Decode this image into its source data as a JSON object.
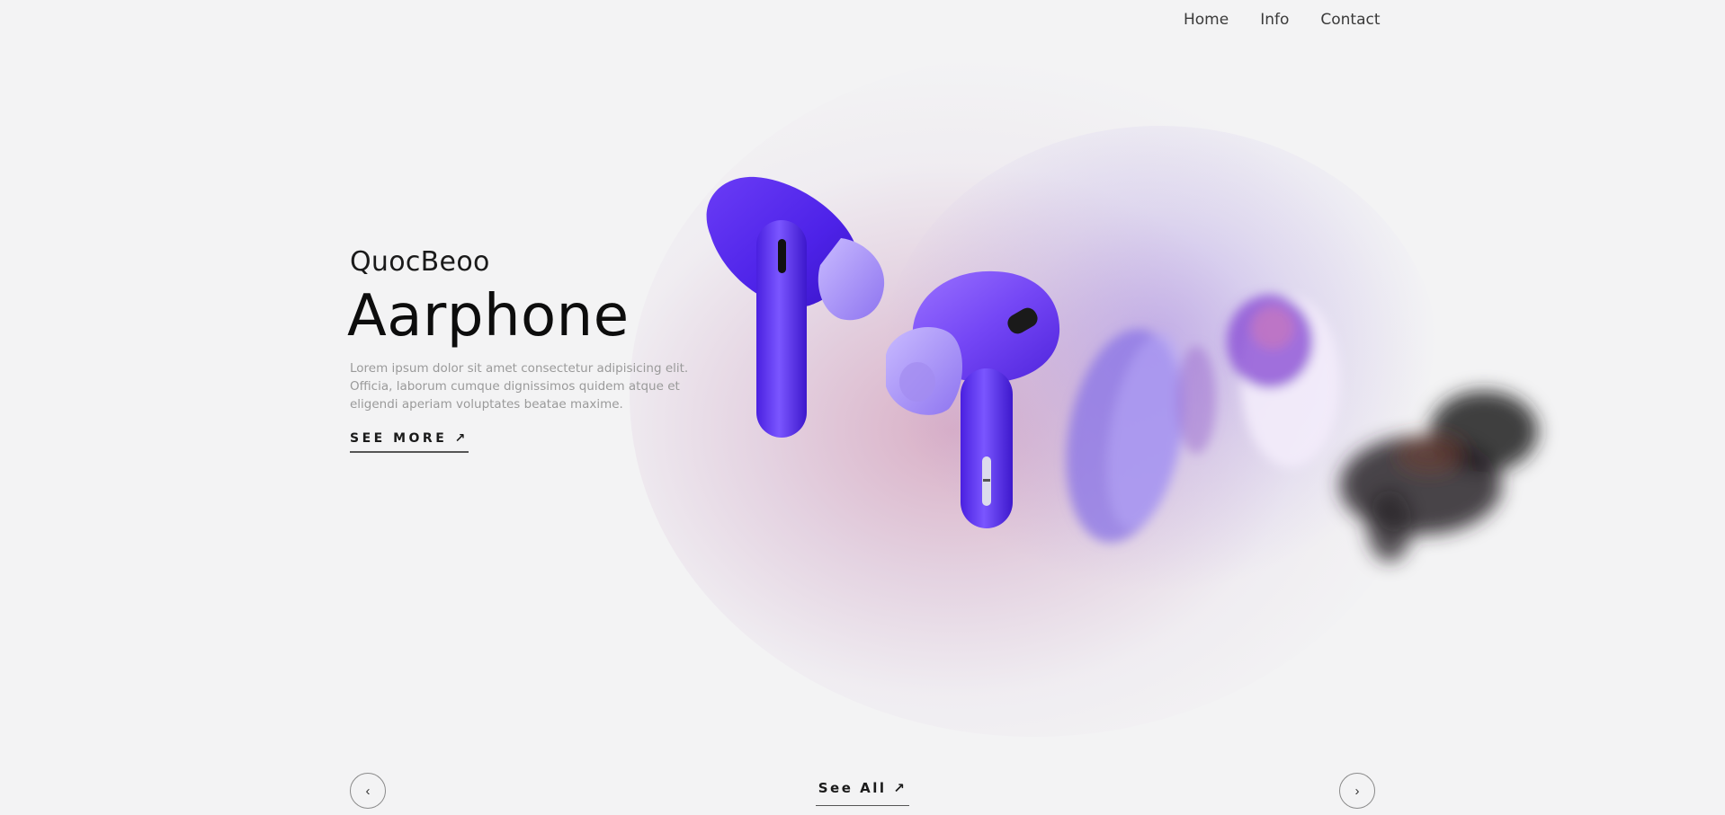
{
  "nav": {
    "items": [
      {
        "label": "Home"
      },
      {
        "label": "Info"
      },
      {
        "label": "Contact"
      }
    ]
  },
  "hero": {
    "brand": "QuocBeoo",
    "title": "Aarphone",
    "description": "Lorem ipsum dolor sit amet consectetur adipisicing elit. Officia, laborum cumque dignissimos quidem atque et eligendi aperiam voluptates beatae maxime.",
    "cta_label": "SEE MORE ↗"
  },
  "footer": {
    "prev_icon": "chevron-left-icon",
    "prev_glyph": "‹",
    "next_icon": "chevron-right-icon",
    "next_glyph": "›",
    "see_all_label": "See All ↗"
  },
  "colors": {
    "background": "#f3f3f4",
    "earbud_primary": "#5b2ef0",
    "earbud_secondary": "#7d52f5",
    "glow_pink": "#c478a0",
    "glow_violet": "#9678e6"
  }
}
